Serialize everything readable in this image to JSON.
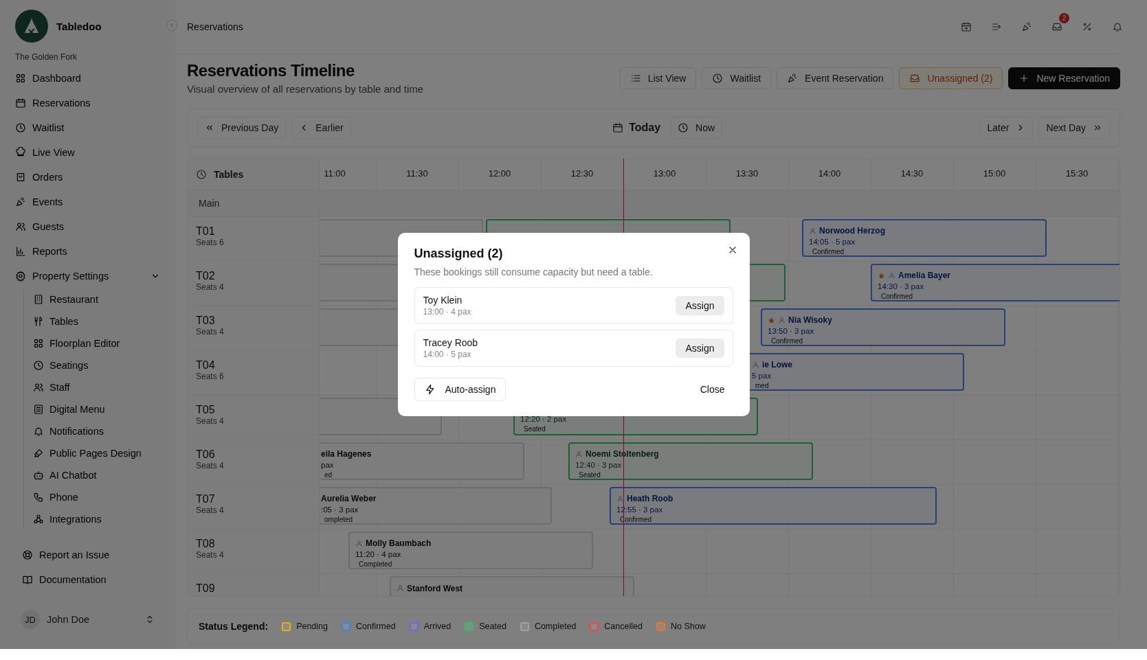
{
  "sidebar": {
    "brand": "Tabledoo",
    "property": "The Golden Fork",
    "items": [
      {
        "label": "Dashboard",
        "selected": false
      },
      {
        "label": "Reservations",
        "selected": false
      },
      {
        "label": "Waitlist",
        "selected": false
      },
      {
        "label": "Live View",
        "selected": false
      },
      {
        "label": "Orders",
        "selected": false
      },
      {
        "label": "Events",
        "selected": false
      },
      {
        "label": "Guests",
        "selected": false
      },
      {
        "label": "Reports",
        "selected": false
      },
      {
        "label": "Property Settings",
        "selected": false,
        "expanded": true,
        "children": [
          {
            "label": "Restaurant",
            "selected": false
          },
          {
            "label": "Tables",
            "selected": false
          },
          {
            "label": "Floorplan Editor",
            "selected": false
          },
          {
            "label": "Seatings",
            "selected": false
          },
          {
            "label": "Staff",
            "selected": false
          },
          {
            "label": "Digital Menu",
            "selected": false
          },
          {
            "label": "Notifications",
            "selected": false
          },
          {
            "label": "Public Pages Design",
            "selected": false
          },
          {
            "label": "AI Chatbot",
            "selected": false
          },
          {
            "label": "Phone",
            "selected": false
          },
          {
            "label": "Integrations",
            "selected": false
          }
        ]
      }
    ],
    "footer_links": [
      {
        "label": "Report an Issue"
      },
      {
        "label": "Documentation"
      }
    ],
    "user": {
      "initials": "JD",
      "name": "John Doe"
    }
  },
  "header": {
    "breadcrumb": "Reservations",
    "inbox_badge": "2"
  },
  "page": {
    "title": "Reservations Timeline",
    "subtitle": "Visual overview of all reservations by table and time",
    "actions": [
      {
        "label": "List View",
        "kind": "outline"
      },
      {
        "label": "Waitlist",
        "kind": "outline"
      },
      {
        "label": "Event Reservation",
        "kind": "outline"
      },
      {
        "label": "Unassigned (2)",
        "kind": "warning"
      },
      {
        "label": "New Reservation",
        "kind": "primary"
      }
    ]
  },
  "day_nav": {
    "previous_day": "Previous Day",
    "earlier": "Earlier",
    "today": "Today",
    "now": "Now",
    "later": "Later",
    "next_day": "Next Day"
  },
  "timeline": {
    "tables_header": "Tables",
    "times": [
      "11:00",
      "11:30",
      "12:00",
      "12:30",
      "13:00",
      "13:30",
      "14:00",
      "14:30",
      "15:00",
      "15:30"
    ],
    "section": "Main",
    "tables": [
      {
        "name": "T01",
        "seats": "Seats 6",
        "bookings": [
          {
            "kind": "completed"
          },
          {
            "kind": "seated"
          },
          {
            "kind": "confirmed",
            "vip": false,
            "name": "Norwood Herzog",
            "meta": "14:05 · 5 pax",
            "status_label": "Confirmed"
          }
        ]
      },
      {
        "name": "T02",
        "seats": "Seats 4",
        "bookings": [
          {
            "kind": "completed"
          },
          {
            "kind": "seated"
          },
          {
            "kind": "confirmed",
            "vip": true,
            "name": "Amelia Bayer",
            "meta": "14:30 · 3 pax",
            "status_label": "Confirmed"
          }
        ]
      },
      {
        "name": "T03",
        "seats": "Seats 4",
        "bookings": [
          {
            "kind": "completed"
          },
          {
            "kind": "confirmed",
            "vip": true,
            "name": "Nia Wisoky",
            "meta": "13:50 · 3 pax",
            "status_label": "Confirmed"
          }
        ]
      },
      {
        "name": "T04",
        "seats": "Seats 6",
        "bookings": [
          {
            "kind": "confirmed",
            "name": "ie Lowe",
            "meta": "5 pax",
            "status_label": "med"
          }
        ]
      },
      {
        "name": "T05",
        "seats": "Seats 4",
        "bookings": [
          {
            "kind": "completed"
          },
          {
            "kind": "seated",
            "meta": "12:20 · 2 pax",
            "status_label": "Seated"
          }
        ]
      },
      {
        "name": "T06",
        "seats": "Seats 4",
        "bookings": [
          {
            "kind": "completed",
            "name": "eila Hagenes",
            "meta": "pax",
            "status_label": "ed"
          },
          {
            "kind": "seated",
            "vip": false,
            "name": "Noemi Stoltenberg",
            "meta": "12:40 · 3 pax",
            "status_label": "Seated"
          }
        ]
      },
      {
        "name": "T07",
        "seats": "Seats 4",
        "bookings": [
          {
            "kind": "completed",
            "name": "Aurelia Weber",
            "meta": ":05 · 3 pax",
            "status_label": "ompleted"
          },
          {
            "kind": "confirmed",
            "vip": false,
            "name": "Heath Roob",
            "meta": "12:55 · 3 pax",
            "status_label": "Confirmed"
          }
        ]
      },
      {
        "name": "T08",
        "seats": "Seats 4",
        "bookings": [
          {
            "kind": "completed",
            "vip": false,
            "name": "Molly Baumbach",
            "meta": "11:20 · 4 pax",
            "status_label": "Completed"
          }
        ]
      },
      {
        "name": "T09",
        "bookings": [
          {
            "kind": "completed",
            "vip": false,
            "name": "Stanford West"
          }
        ]
      }
    ]
  },
  "legend": {
    "title": "Status Legend:",
    "items": [
      {
        "label": "Pending",
        "color": "#eab308"
      },
      {
        "label": "Confirmed",
        "color": "#3b82f6"
      },
      {
        "label": "Arrived",
        "color": "#6366f1"
      },
      {
        "label": "Seated",
        "color": "#22c55e"
      },
      {
        "label": "Completed",
        "color": "#9ca3af"
      },
      {
        "label": "Cancelled",
        "color": "#ef4444"
      },
      {
        "label": "No Show",
        "color": "#f97316"
      }
    ]
  },
  "modal": {
    "title": "Unassigned (2)",
    "description": "These bookings still consume capacity but need a table.",
    "bookings": [
      {
        "name": "Toy Klein",
        "meta": "13:00 · 4 pax",
        "action": "Assign"
      },
      {
        "name": "Tracey Roob",
        "meta": "14:00 · 5 pax",
        "action": "Assign"
      }
    ],
    "auto_assign": "Auto-assign",
    "close": "Close"
  }
}
